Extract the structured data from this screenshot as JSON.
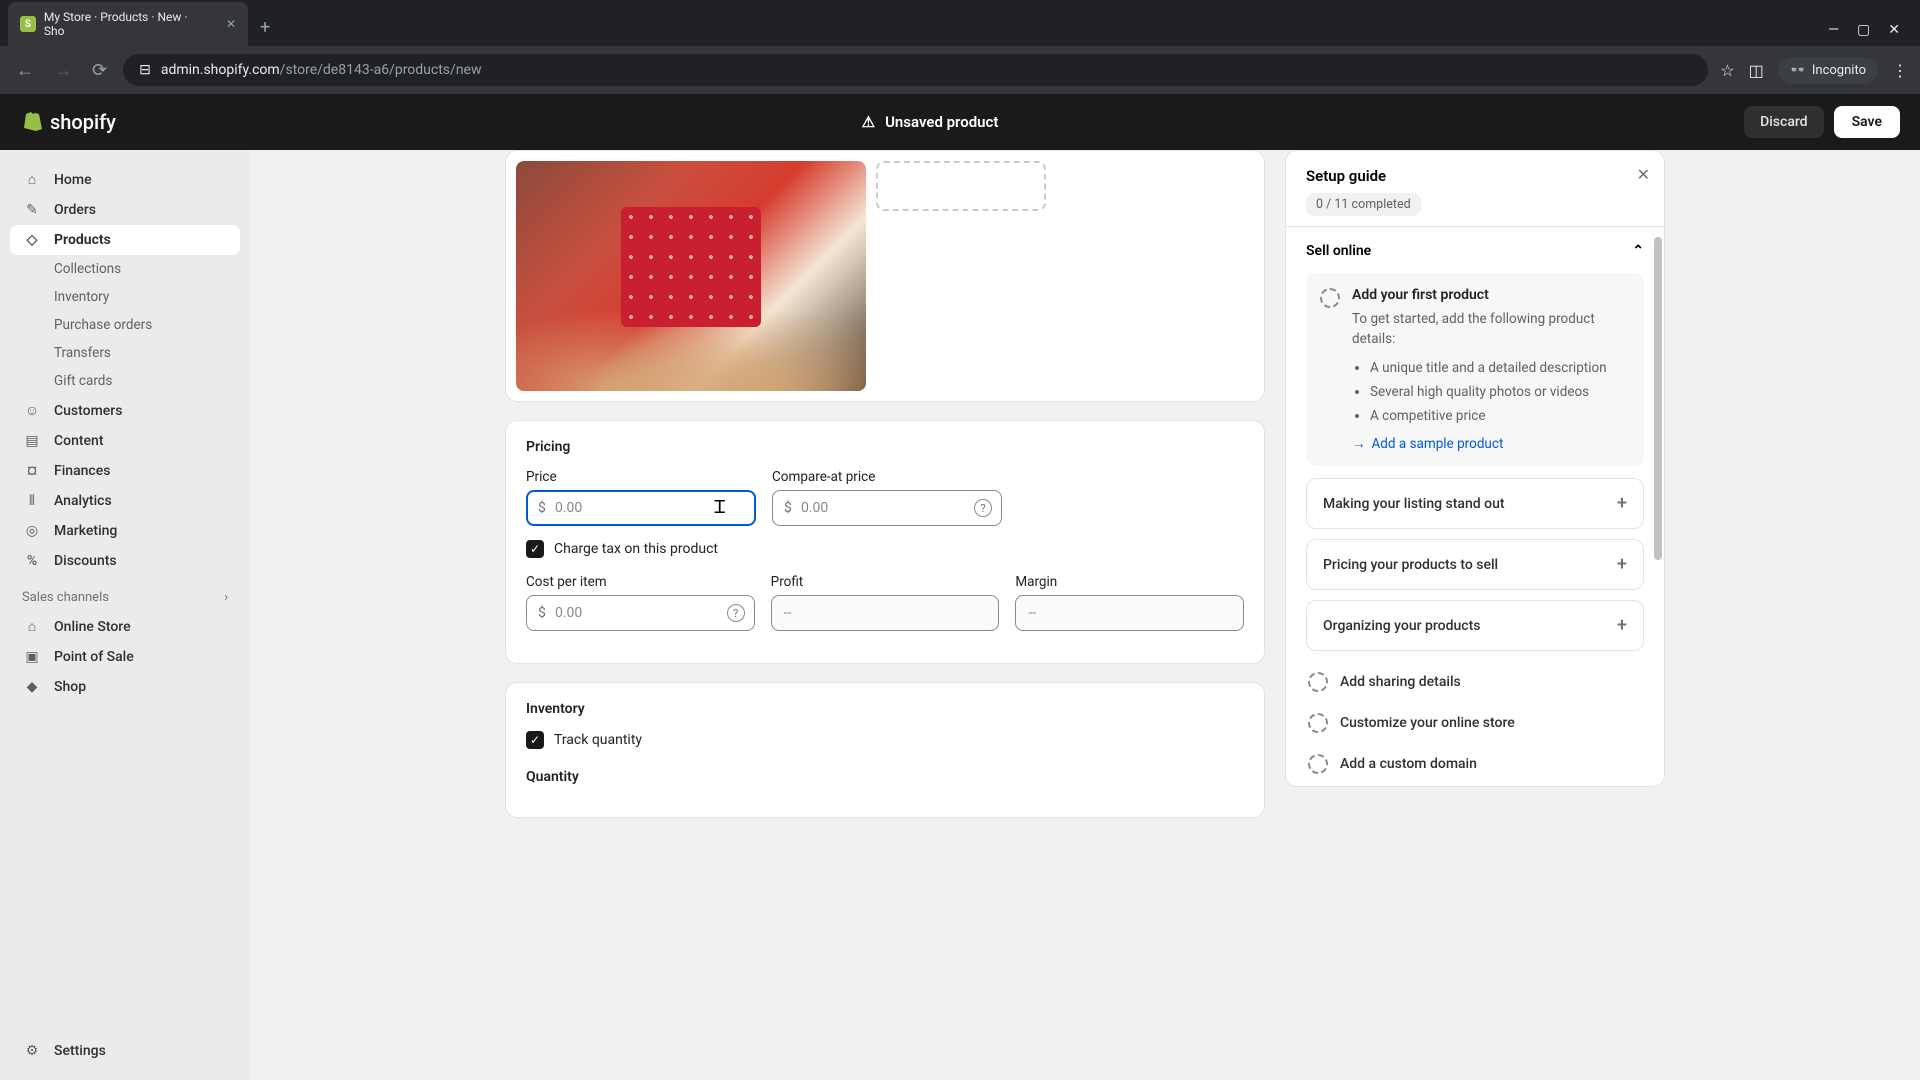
{
  "browser": {
    "tab_title": "My Store · Products · New · Sho",
    "url_display": "admin.shopify.com/store/de8143-a6/products/new",
    "incognito_label": "Incognito"
  },
  "header": {
    "brand": "shopify",
    "status": "Unsaved product",
    "discard": "Discard",
    "save": "Save"
  },
  "sidebar": {
    "home": "Home",
    "orders": "Orders",
    "products": "Products",
    "collections": "Collections",
    "inventory": "Inventory",
    "purchase_orders": "Purchase orders",
    "transfers": "Transfers",
    "gift_cards": "Gift cards",
    "customers": "Customers",
    "content": "Content",
    "finances": "Finances",
    "analytics": "Analytics",
    "marketing": "Marketing",
    "discounts": "Discounts",
    "sales_channels": "Sales channels",
    "online_store": "Online Store",
    "point_of_sale": "Point of Sale",
    "shop": "Shop",
    "settings": "Settings"
  },
  "pricing": {
    "title": "Pricing",
    "price_label": "Price",
    "price_placeholder": "0.00",
    "compare_label": "Compare-at price",
    "compare_placeholder": "0.00",
    "charge_tax": "Charge tax on this product",
    "cost_label": "Cost per item",
    "cost_placeholder": "0.00",
    "profit_label": "Profit",
    "profit_placeholder": "--",
    "margin_label": "Margin",
    "margin_placeholder": "--",
    "currency": "$"
  },
  "inventory": {
    "title": "Inventory",
    "track_quantity": "Track quantity",
    "quantity": "Quantity"
  },
  "setup": {
    "title": "Setup guide",
    "progress": "0 / 11 completed",
    "sell_online": "Sell online",
    "add_first_product": "Add your first product",
    "add_first_desc": "To get started, add the following product details:",
    "bullet1": "A unique title and a detailed description",
    "bullet2": "Several high quality photos or videos",
    "bullet3": "A competitive price",
    "add_sample": "Add a sample product",
    "making_listing": "Making your listing stand out",
    "pricing_products": "Pricing your products to sell",
    "organizing": "Organizing your products",
    "sharing_details": "Add sharing details",
    "customize_store": "Customize your online store",
    "custom_domain": "Add a custom domain"
  }
}
